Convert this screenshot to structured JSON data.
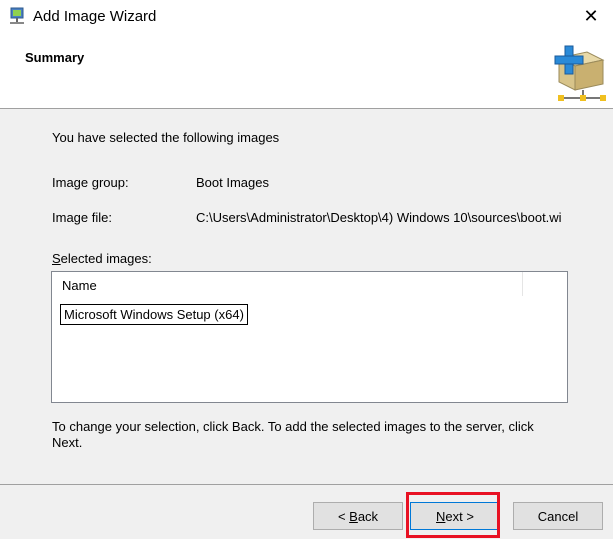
{
  "window": {
    "title": "Add Image Wizard",
    "close_glyph": "✕",
    "icon": "server-app-icon"
  },
  "header": {
    "title": "Summary",
    "icon": "add-box-network-icon"
  },
  "content": {
    "intro": "You have selected the following images",
    "image_group_label": "Image group:",
    "image_group_value": "Boot Images",
    "image_file_label": "Image file:",
    "image_file_value": "C:\\Users\\Administrator\\Desktop\\4) Windows 10\\sources\\boot.wi",
    "selected_images_label_accel": "S",
    "selected_images_label_rest": "elected images:",
    "list": {
      "column_header": "Name",
      "items": [
        "Microsoft Windows Setup (x64)"
      ]
    },
    "footer_note": "To change your selection, click Back. To add the selected images to the server, click Next."
  },
  "buttons": {
    "back_prefix": "< ",
    "back_accel": "B",
    "back_rest": "ack",
    "next_accel": "N",
    "next_rest": "ext >",
    "cancel": "Cancel"
  },
  "colors": {
    "highlight": "#e81123",
    "accent": "#0078d7"
  }
}
